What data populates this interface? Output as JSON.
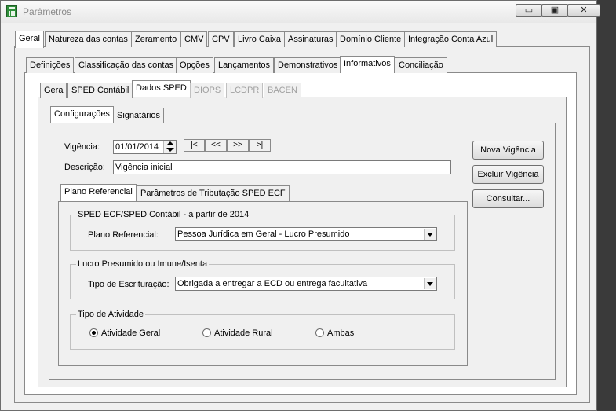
{
  "window": {
    "title": "Parâmetros",
    "minimize": "▭",
    "restore": "▣",
    "close": "✕"
  },
  "tabs_l1": [
    "Geral",
    "Natureza das contas",
    "Zeramento",
    "CMV",
    "CPV",
    "Livro Caixa",
    "Assinaturas",
    "Domínio Cliente",
    "Integração Conta Azul"
  ],
  "tabs_l2": [
    "Definições",
    "Classificação das contas",
    "Opções",
    "Lançamentos",
    "Demonstrativos",
    "Informativos",
    "Conciliação"
  ],
  "tabs_l3": [
    "Gera",
    "SPED Contábil",
    "Dados SPED",
    "DIOPS",
    "LCDPR",
    "BACEN"
  ],
  "tabs_l4": [
    "Configurações",
    "Signatários"
  ],
  "vigencia": {
    "label": "Vigência:",
    "value": "01/01/2014",
    "nav": [
      "|<",
      "<<",
      ">>",
      ">|"
    ]
  },
  "descricao": {
    "label": "Descrição:",
    "value": "Vigência inicial"
  },
  "buttons": {
    "nova": "Nova Vigência",
    "excluir": "Excluir Vigência",
    "consultar": "Consultar..."
  },
  "tabs_l5": [
    "Plano Referencial",
    "Parâmetros de Tributação SPED ECF"
  ],
  "group_sped": {
    "title": "SPED ECF/SPED Contábil - a partir de 2014",
    "label": "Plano Referencial:",
    "value": "Pessoa Jurídica em Geral - Lucro Presumido"
  },
  "group_lucro": {
    "title": "Lucro Presumido ou Imune/Isenta",
    "label": "Tipo de Escrituração:",
    "value": "Obrigada a entregar a ECD ou entrega facultativa"
  },
  "group_atividade": {
    "title": "Tipo de Atividade",
    "options": [
      "Atividade Geral",
      "Atividade Rural",
      "Ambas"
    ],
    "selected": "Atividade Geral"
  }
}
